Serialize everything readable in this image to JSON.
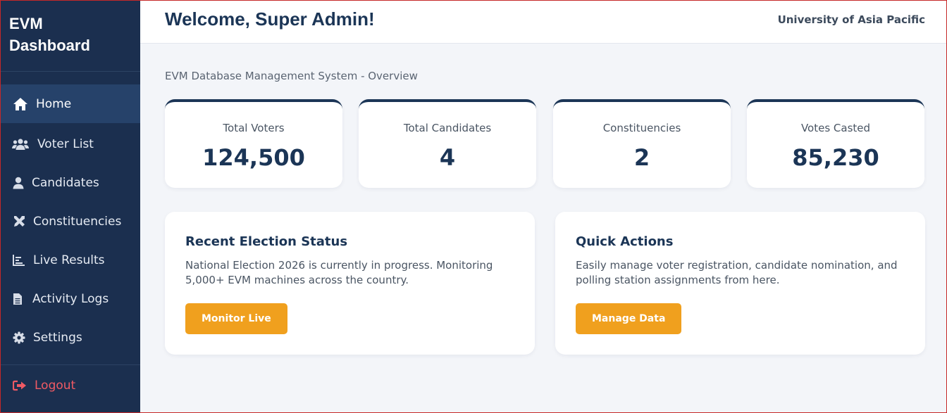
{
  "sidebar": {
    "brand_line1": "EVM",
    "brand_line2": "Dashboard",
    "items": [
      {
        "label": "Home",
        "icon": "home-icon",
        "active": true
      },
      {
        "label": "Voter List",
        "icon": "users-icon"
      },
      {
        "label": "Candidates",
        "icon": "user-icon"
      },
      {
        "label": "Constituencies",
        "icon": "tools-icon"
      },
      {
        "label": "Live Results",
        "icon": "chart-icon"
      },
      {
        "label": "Activity Logs",
        "icon": "file-icon"
      },
      {
        "label": "Settings",
        "icon": "gear-icon"
      }
    ],
    "logout": {
      "label": "Logout",
      "icon": "logout-icon"
    }
  },
  "header": {
    "welcome": "Welcome, Super Admin!",
    "org": "University of Asia Pacific"
  },
  "main": {
    "subtitle": "EVM Database Management System - Overview",
    "stats": [
      {
        "label": "Total Voters",
        "value": "124,500"
      },
      {
        "label": "Total Candidates",
        "value": "4"
      },
      {
        "label": "Constituencies",
        "value": "2"
      },
      {
        "label": "Votes Casted",
        "value": "85,230"
      }
    ],
    "panels": [
      {
        "title": "Recent Election Status",
        "text": "National Election 2026 is currently in progress. Monitoring 5,000+ EVM machines across the country.",
        "button": "Monitor Live"
      },
      {
        "title": "Quick Actions",
        "text": "Easily manage voter registration, candidate nomination, and polling station assignments from here.",
        "button": "Manage Data"
      }
    ]
  },
  "colors": {
    "sidebar_bg": "#1b2f4f",
    "active_bg": "#26426a",
    "accent": "#f0a01e",
    "primary_text": "#1b3556",
    "logout": "#ef5a64"
  }
}
